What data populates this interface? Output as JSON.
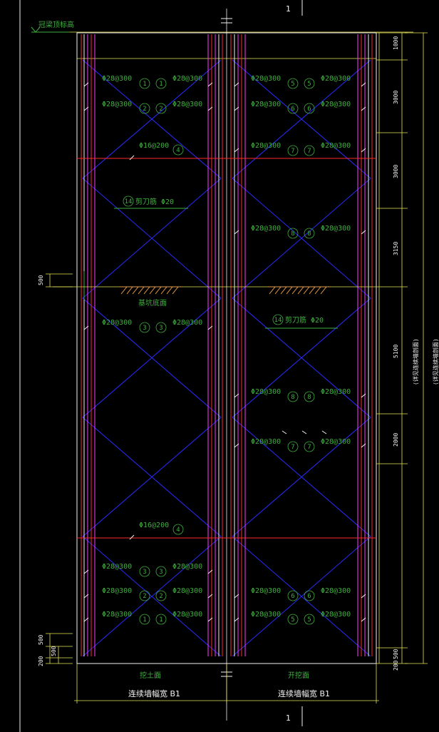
{
  "section_number_top": "1",
  "section_number_bottom": "1",
  "top_elevation_label": "冠梁顶标高",
  "pit_bottom_label": "基坑底面",
  "bottom_left_label": "挖土面",
  "bottom_right_label": "开挖面",
  "width_left": "连续墙幅宽 B1",
  "width_right": "连续墙幅宽 B1",
  "right_total_label": "(详见连续墙剖面)",
  "right_total_label_2": "(详见连续墙剖面)",
  "dims_right": [
    "1000",
    "3000",
    "3000",
    "3150",
    "5100",
    "2000",
    "500"
  ],
  "dims_left": [
    "500",
    "500",
    "500",
    "200"
  ],
  "dim_bottom_right": "200",
  "rebar_labels": {
    "l1": "Φ28@300",
    "l2": "Φ28@300",
    "l3": "Φ28@300",
    "l4": "Φ28@300",
    "l5": "Φ28@300",
    "l6": "Φ28@300",
    "l7": "Φ28@300",
    "l8": "Φ28@300",
    "l9": "Φ28@300",
    "l10": "Φ28@300",
    "l11": "Φ28@300",
    "l12": "Φ28@300",
    "l13": "Φ28@300",
    "l14": "Φ28@300",
    "l15": "Φ28@300",
    "l16": "Φ28@300",
    "l17": "Φ28@300",
    "l18": "Φ28@300",
    "l19": "Φ28@300",
    "l20": "Φ28@300",
    "l21": "Φ28@300",
    "l22": "Φ28@300",
    "l23": "Φ28@300",
    "l24": "Φ28@300",
    "h1": "Φ16@200",
    "h2": "Φ16@200",
    "s1": "剪刀筋 Φ20",
    "s2": "剪刀筋 Φ20"
  },
  "marks": {
    "m1": "1",
    "m2": "2",
    "m3": "3",
    "m4": "4",
    "m5": "5",
    "m6": "6",
    "m7": "7",
    "m8": "8",
    "m14": "14"
  },
  "colors": {
    "background": "#000000",
    "outline": "#ffffff",
    "rebar_red": "#ff2a2a",
    "rebar_magenta": "#ff3cff",
    "rebar_white": "#f2f2f2",
    "rebar_green": "#3fae3f",
    "diagonal_blue": "#2a2aff",
    "dimension_yellow": "#e7e455",
    "hatch_orange": "#e8a24a"
  }
}
